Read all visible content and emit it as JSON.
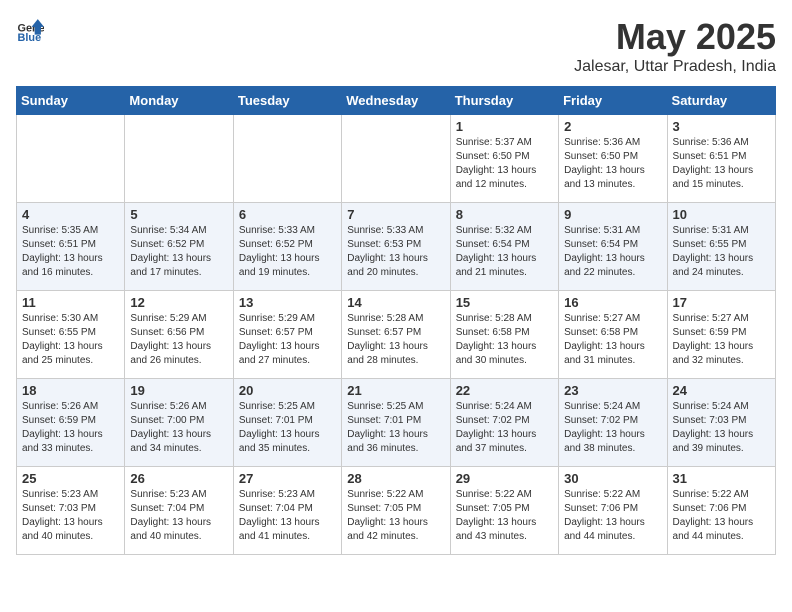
{
  "header": {
    "logo_general": "General",
    "logo_blue": "Blue",
    "month": "May 2025",
    "location": "Jalesar, Uttar Pradesh, India"
  },
  "days_of_week": [
    "Sunday",
    "Monday",
    "Tuesday",
    "Wednesday",
    "Thursday",
    "Friday",
    "Saturday"
  ],
  "weeks": [
    [
      {
        "day": "",
        "info": ""
      },
      {
        "day": "",
        "info": ""
      },
      {
        "day": "",
        "info": ""
      },
      {
        "day": "",
        "info": ""
      },
      {
        "day": "1",
        "info": "Sunrise: 5:37 AM\nSunset: 6:50 PM\nDaylight: 13 hours\nand 12 minutes."
      },
      {
        "day": "2",
        "info": "Sunrise: 5:36 AM\nSunset: 6:50 PM\nDaylight: 13 hours\nand 13 minutes."
      },
      {
        "day": "3",
        "info": "Sunrise: 5:36 AM\nSunset: 6:51 PM\nDaylight: 13 hours\nand 15 minutes."
      }
    ],
    [
      {
        "day": "4",
        "info": "Sunrise: 5:35 AM\nSunset: 6:51 PM\nDaylight: 13 hours\nand 16 minutes."
      },
      {
        "day": "5",
        "info": "Sunrise: 5:34 AM\nSunset: 6:52 PM\nDaylight: 13 hours\nand 17 minutes."
      },
      {
        "day": "6",
        "info": "Sunrise: 5:33 AM\nSunset: 6:52 PM\nDaylight: 13 hours\nand 19 minutes."
      },
      {
        "day": "7",
        "info": "Sunrise: 5:33 AM\nSunset: 6:53 PM\nDaylight: 13 hours\nand 20 minutes."
      },
      {
        "day": "8",
        "info": "Sunrise: 5:32 AM\nSunset: 6:54 PM\nDaylight: 13 hours\nand 21 minutes."
      },
      {
        "day": "9",
        "info": "Sunrise: 5:31 AM\nSunset: 6:54 PM\nDaylight: 13 hours\nand 22 minutes."
      },
      {
        "day": "10",
        "info": "Sunrise: 5:31 AM\nSunset: 6:55 PM\nDaylight: 13 hours\nand 24 minutes."
      }
    ],
    [
      {
        "day": "11",
        "info": "Sunrise: 5:30 AM\nSunset: 6:55 PM\nDaylight: 13 hours\nand 25 minutes."
      },
      {
        "day": "12",
        "info": "Sunrise: 5:29 AM\nSunset: 6:56 PM\nDaylight: 13 hours\nand 26 minutes."
      },
      {
        "day": "13",
        "info": "Sunrise: 5:29 AM\nSunset: 6:57 PM\nDaylight: 13 hours\nand 27 minutes."
      },
      {
        "day": "14",
        "info": "Sunrise: 5:28 AM\nSunset: 6:57 PM\nDaylight: 13 hours\nand 28 minutes."
      },
      {
        "day": "15",
        "info": "Sunrise: 5:28 AM\nSunset: 6:58 PM\nDaylight: 13 hours\nand 30 minutes."
      },
      {
        "day": "16",
        "info": "Sunrise: 5:27 AM\nSunset: 6:58 PM\nDaylight: 13 hours\nand 31 minutes."
      },
      {
        "day": "17",
        "info": "Sunrise: 5:27 AM\nSunset: 6:59 PM\nDaylight: 13 hours\nand 32 minutes."
      }
    ],
    [
      {
        "day": "18",
        "info": "Sunrise: 5:26 AM\nSunset: 6:59 PM\nDaylight: 13 hours\nand 33 minutes."
      },
      {
        "day": "19",
        "info": "Sunrise: 5:26 AM\nSunset: 7:00 PM\nDaylight: 13 hours\nand 34 minutes."
      },
      {
        "day": "20",
        "info": "Sunrise: 5:25 AM\nSunset: 7:01 PM\nDaylight: 13 hours\nand 35 minutes."
      },
      {
        "day": "21",
        "info": "Sunrise: 5:25 AM\nSunset: 7:01 PM\nDaylight: 13 hours\nand 36 minutes."
      },
      {
        "day": "22",
        "info": "Sunrise: 5:24 AM\nSunset: 7:02 PM\nDaylight: 13 hours\nand 37 minutes."
      },
      {
        "day": "23",
        "info": "Sunrise: 5:24 AM\nSunset: 7:02 PM\nDaylight: 13 hours\nand 38 minutes."
      },
      {
        "day": "24",
        "info": "Sunrise: 5:24 AM\nSunset: 7:03 PM\nDaylight: 13 hours\nand 39 minutes."
      }
    ],
    [
      {
        "day": "25",
        "info": "Sunrise: 5:23 AM\nSunset: 7:03 PM\nDaylight: 13 hours\nand 40 minutes."
      },
      {
        "day": "26",
        "info": "Sunrise: 5:23 AM\nSunset: 7:04 PM\nDaylight: 13 hours\nand 40 minutes."
      },
      {
        "day": "27",
        "info": "Sunrise: 5:23 AM\nSunset: 7:04 PM\nDaylight: 13 hours\nand 41 minutes."
      },
      {
        "day": "28",
        "info": "Sunrise: 5:22 AM\nSunset: 7:05 PM\nDaylight: 13 hours\nand 42 minutes."
      },
      {
        "day": "29",
        "info": "Sunrise: 5:22 AM\nSunset: 7:05 PM\nDaylight: 13 hours\nand 43 minutes."
      },
      {
        "day": "30",
        "info": "Sunrise: 5:22 AM\nSunset: 7:06 PM\nDaylight: 13 hours\nand 44 minutes."
      },
      {
        "day": "31",
        "info": "Sunrise: 5:22 AM\nSunset: 7:06 PM\nDaylight: 13 hours\nand 44 minutes."
      }
    ]
  ]
}
